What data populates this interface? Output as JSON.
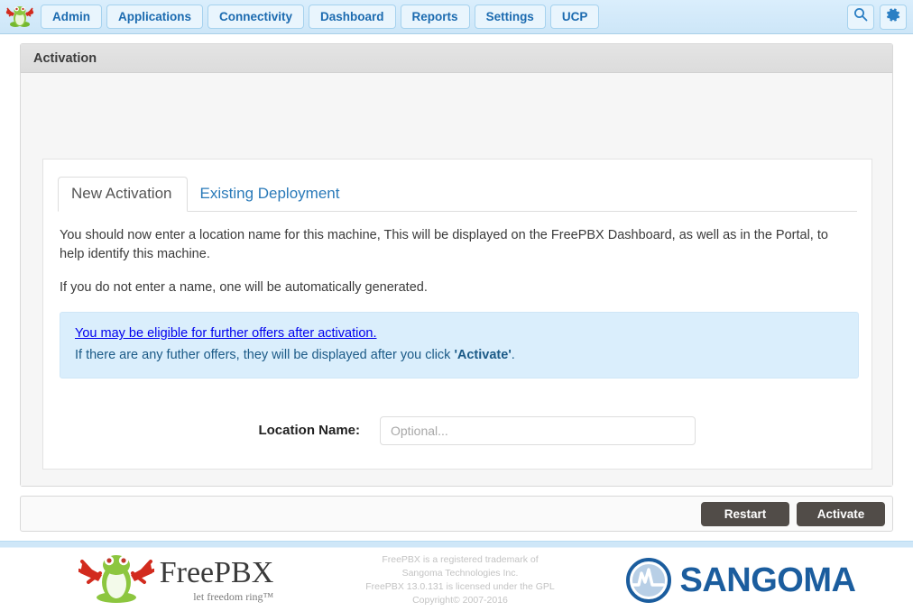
{
  "navbar": {
    "logo_icon": "freepbx-frog-logo",
    "items": [
      {
        "label": "Admin"
      },
      {
        "label": "Applications"
      },
      {
        "label": "Connectivity"
      },
      {
        "label": "Dashboard"
      },
      {
        "label": "Reports"
      },
      {
        "label": "Settings"
      },
      {
        "label": "UCP"
      }
    ],
    "search_icon": "search-icon",
    "settings_icon": "gear-icon"
  },
  "panel": {
    "title": "Activation"
  },
  "tabs": [
    {
      "label": "New Activation",
      "active": true
    },
    {
      "label": "Existing Deployment",
      "active": false
    }
  ],
  "content": {
    "paragraph1": "You should now enter a location name for this machine, This will be displayed on the FreePBX Dashboard, as well as in the Portal, to help identify this machine.",
    "paragraph2": "If you do not enter a name, one will be automatically generated.",
    "alert": {
      "link_text": "You may be eligible for further offers after activation.",
      "line2_before": "If there are any futher offers, they will be displayed after you click ",
      "line2_strong": "'Activate'",
      "line2_after": "."
    },
    "form": {
      "location_label": "Location Name:",
      "location_value": "",
      "location_placeholder": "Optional..."
    }
  },
  "actions": {
    "restart_label": "Restart",
    "activate_label": "Activate"
  },
  "footer": {
    "freepbx_logo_icon": "freepbx-frog-logo",
    "freepbx_wordmark": "FreePBX",
    "freepbx_tagline": "let freedom ring™",
    "legal_lines": [
      "FreePBX is a registered trademark of",
      "Sangoma Technologies Inc.",
      "FreePBX 13.0.131 is licensed under the GPL",
      "Copyright© 2007-2016"
    ],
    "sangoma_logo_icon": "sangoma-waveform-logo",
    "sangoma_wordmark": "SANGOMA"
  },
  "colors": {
    "nav_blue": "#cde6f8",
    "link_blue": "#2a7ab9",
    "alert_bg": "#daeefc",
    "alert_text": "#1b5a87",
    "button_dark": "#514c48",
    "sangoma_blue": "#1b5d9e"
  }
}
